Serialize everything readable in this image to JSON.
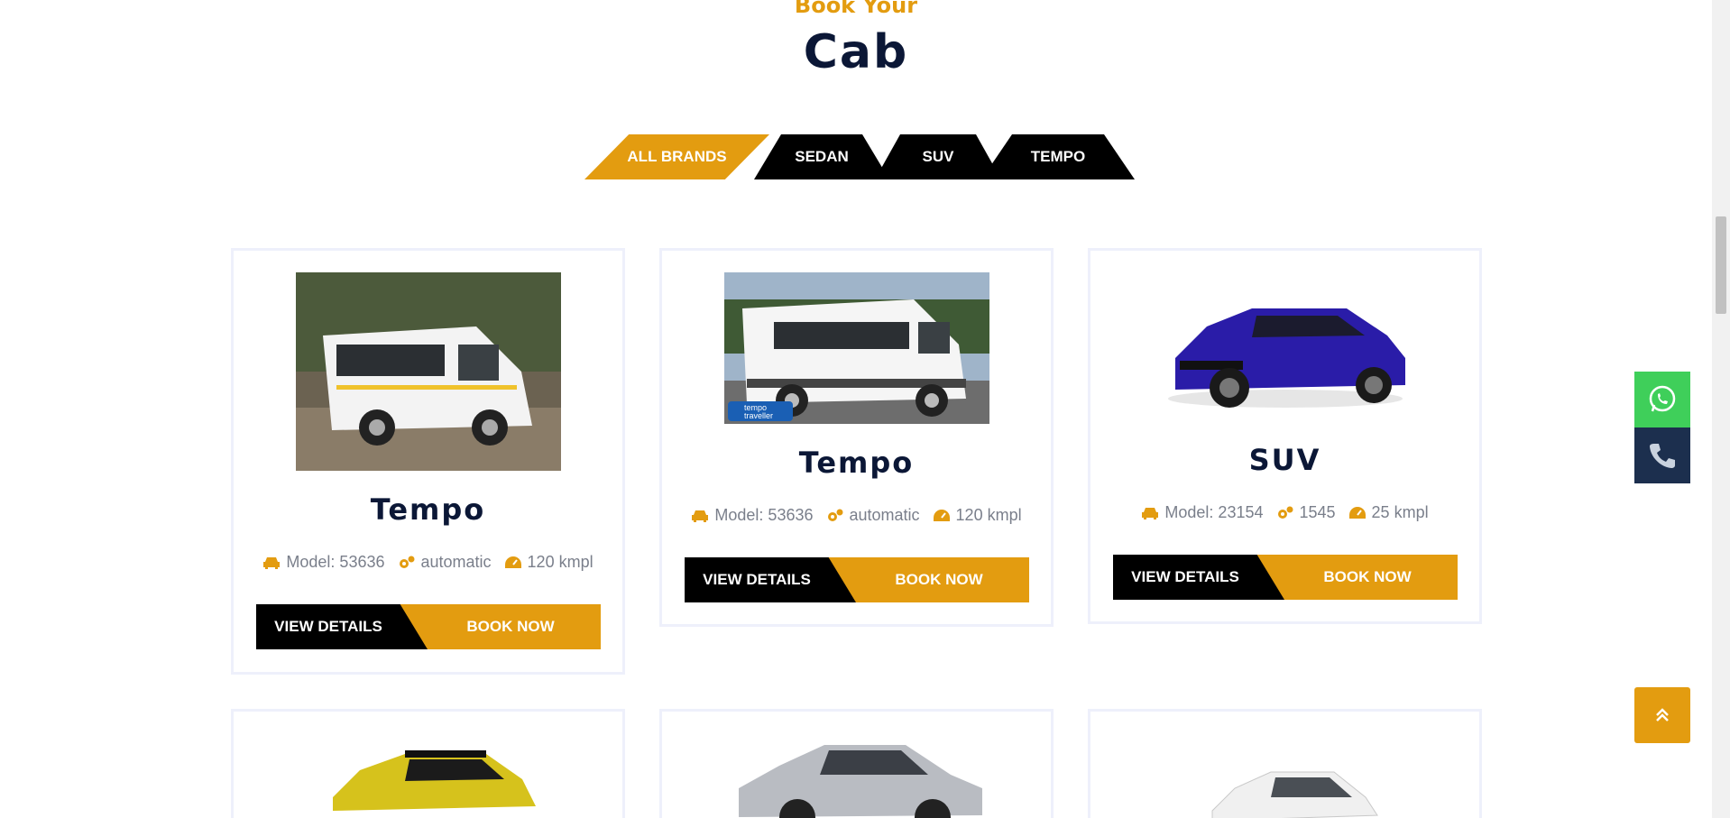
{
  "section": {
    "subtitle": "Book Your",
    "title": "Cab"
  },
  "tabs": [
    {
      "label": "ALL BRANDS",
      "active": true
    },
    {
      "label": "SEDAN",
      "active": false
    },
    {
      "label": "SUV",
      "active": false
    },
    {
      "label": "TEMPO",
      "active": false
    }
  ],
  "cards": [
    {
      "title": "Tempo",
      "model": "Model: 53636",
      "transmission": "automatic",
      "mileage": "120 kmpl",
      "view_label": "VIEW DETAILS",
      "book_label": "BOOK NOW",
      "image": "white-tempo-traveller-photo"
    },
    {
      "title": "Tempo",
      "model": "Model: 53636",
      "transmission": "automatic",
      "mileage": "120 kmpl",
      "view_label": "VIEW DETAILS",
      "book_label": "BOOK NOW",
      "image": "white-minibus-photo",
      "image_caption": "tempo traveller"
    },
    {
      "title": "SUV",
      "model": "Model: 23154",
      "transmission": "1545",
      "mileage": "25 kmpl",
      "view_label": "VIEW DETAILS",
      "book_label": "BOOK NOW",
      "image": "blue-suv-photo"
    }
  ],
  "row2_images": [
    "yellow-compact-suv-photo",
    "silver-sedan-photo",
    "white-mpv-photo"
  ],
  "floating": {
    "whatsapp": "whatsapp-icon",
    "call": "phone-icon",
    "top": "double-chevron-up-icon"
  },
  "colors": {
    "accent": "#e39c10",
    "dark": "#000000",
    "title": "#0b1736",
    "whatsapp": "#3fcf5a",
    "call": "#1c2f4e"
  }
}
